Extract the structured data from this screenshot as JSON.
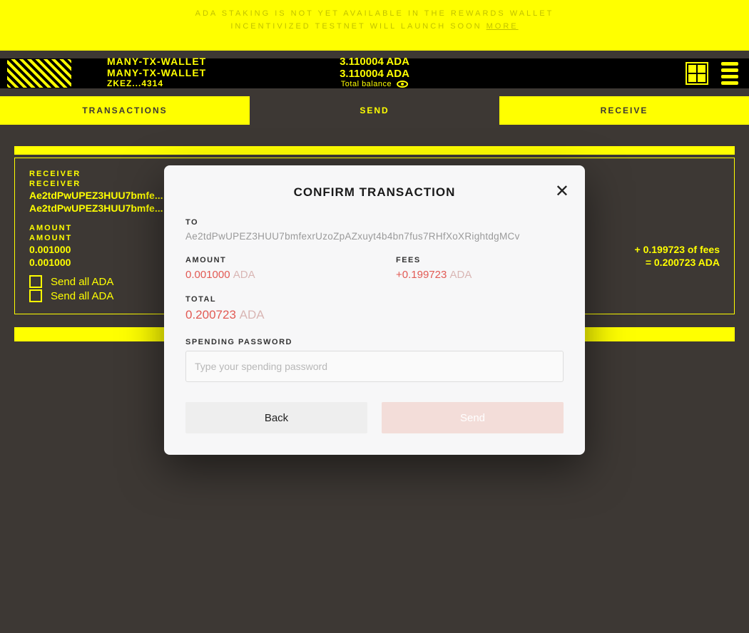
{
  "banner": {
    "line1": "ADA STAKING IS NOT YET AVAILABLE IN THE REWARDS WALLET",
    "line2_prefix": "INCENTIVIZED TESTNET WILL LAUNCH SOON ",
    "more": "MORE"
  },
  "wallet": {
    "name": "MANY-TX-WALLET",
    "name_dup": "MANY-TX-WALLET",
    "addr_short": "ZKEZ...4314",
    "balance": "3.110004 ADA",
    "balance_dup": "3.110004 ADA",
    "total_balance_label": "Total balance"
  },
  "tabs": {
    "transactions": "TRANSACTIONS",
    "send": "SEND",
    "receive": "RECEIVE"
  },
  "form": {
    "receiver_label": "RECEIVER",
    "receiver_value": "Ae2tdPwUPEZ3HUU7bmfe...",
    "amount_label": "AMOUNT",
    "amount_value": "0.001000",
    "fees_note": "+ 0.199723 of fees",
    "total_note": "= 0.200723 ADA",
    "send_all": "Send all ADA"
  },
  "modal": {
    "title": "CONFIRM TRANSACTION",
    "to_label": "TO",
    "to_value": "Ae2tdPwUPEZ3HUU7bmfexrUzoZpAZxuyt4b4bn7fus7RHfXoXRightdgMCv",
    "amount_label": "AMOUNT",
    "amount_value": "0.001000",
    "amount_unit": "ADA",
    "fees_label": "FEES",
    "fees_value": "+0.199723",
    "fees_unit": "ADA",
    "total_label": "TOTAL",
    "total_value": "0.200723",
    "total_unit": "ADA",
    "pw_label": "SPENDING PASSWORD",
    "pw_placeholder": "Type your spending password",
    "back": "Back",
    "send": "Send"
  }
}
